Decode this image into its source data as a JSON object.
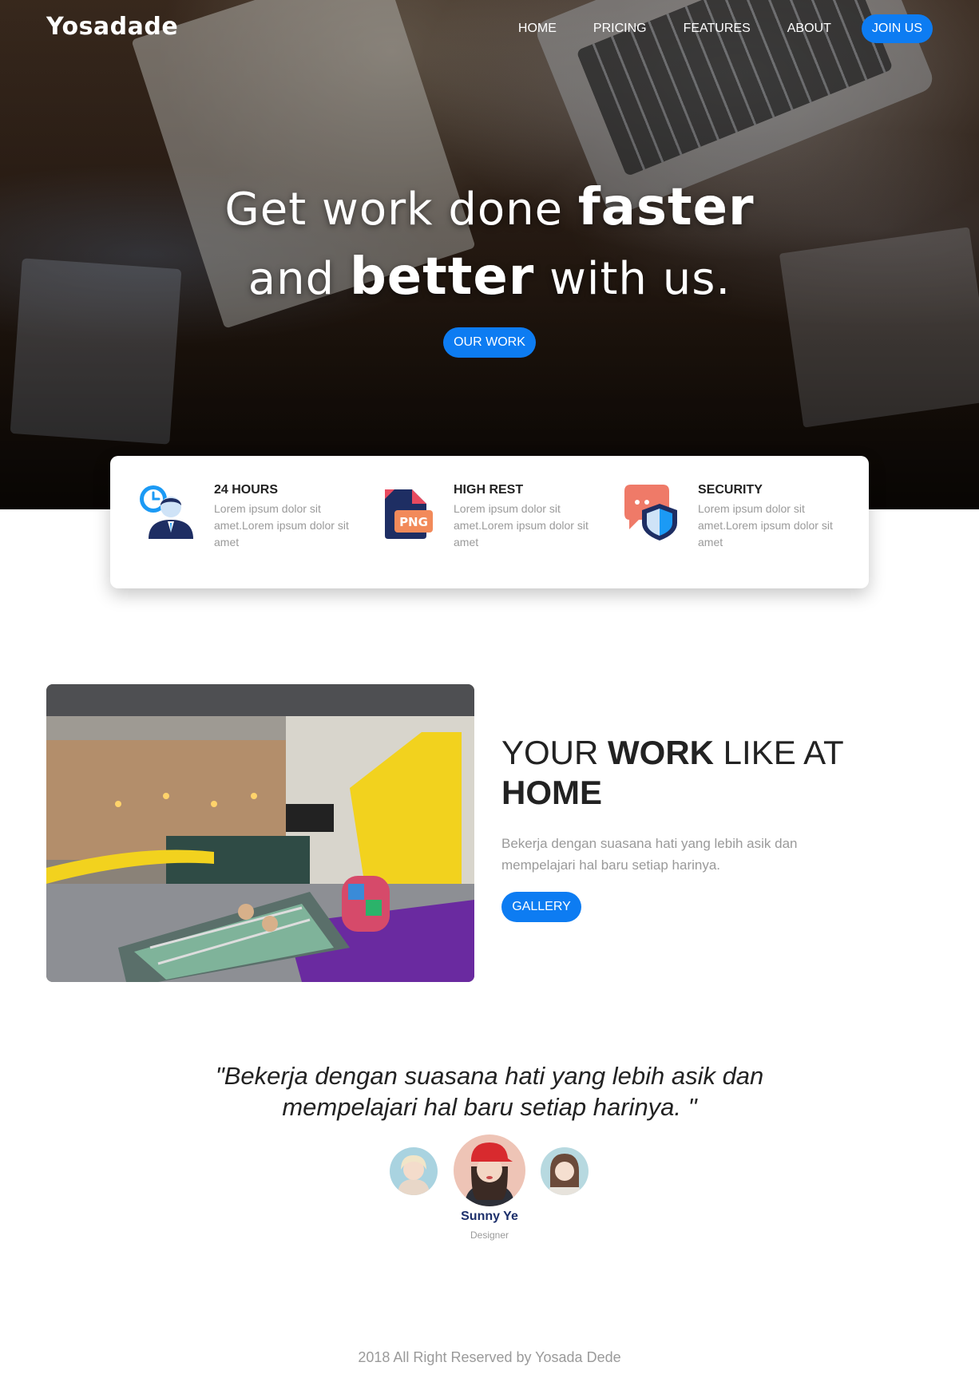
{
  "header": {
    "logo": "Yosadade",
    "nav": [
      "HOME",
      "PRICING",
      "FEATURES",
      "ABOUT"
    ],
    "join_label": "JOIN US"
  },
  "hero": {
    "line1_prefix": "Get work done ",
    "line1_bold": "faster",
    "line2_prefix": "and ",
    "line2_bold": "better",
    "line2_suffix": " with us.",
    "button": "OUR WORK"
  },
  "features": [
    {
      "icon": "clock-person-icon",
      "title": "24 HOURS",
      "desc": "Lorem ipsum dolor sit amet.Lorem ipsum dolor sit amet"
    },
    {
      "icon": "png-file-icon",
      "title": "HIGH REST",
      "desc": "Lorem ipsum dolor sit amet.Lorem ipsum dolor sit amet"
    },
    {
      "icon": "security-shield-icon",
      "title": "SECURITY",
      "desc": "Lorem ipsum dolor sit amet.Lorem ipsum dolor sit amet"
    }
  ],
  "work": {
    "title_1": "YOUR ",
    "title_bold_1": "WORK",
    "title_2": " LIKE AT",
    "title_bold_2": "HOME",
    "text": "Bekerja dengan suasana hati yang lebih asik dan mempelajari hal baru setiap harinya.",
    "button": "GALLERY"
  },
  "testimonial": {
    "quote": "\"Bekerja dengan suasana hati yang lebih asik dan mempelajari hal baru setiap harinya. \"",
    "name": "Sunny Ye",
    "role": "Designer"
  },
  "footer": {
    "text": "2018 All Right Reserved by Yosada Dede"
  },
  "colors": {
    "accent": "#0d7cf2",
    "name": "#1c2f6b",
    "muted": "#9a9a9a"
  }
}
